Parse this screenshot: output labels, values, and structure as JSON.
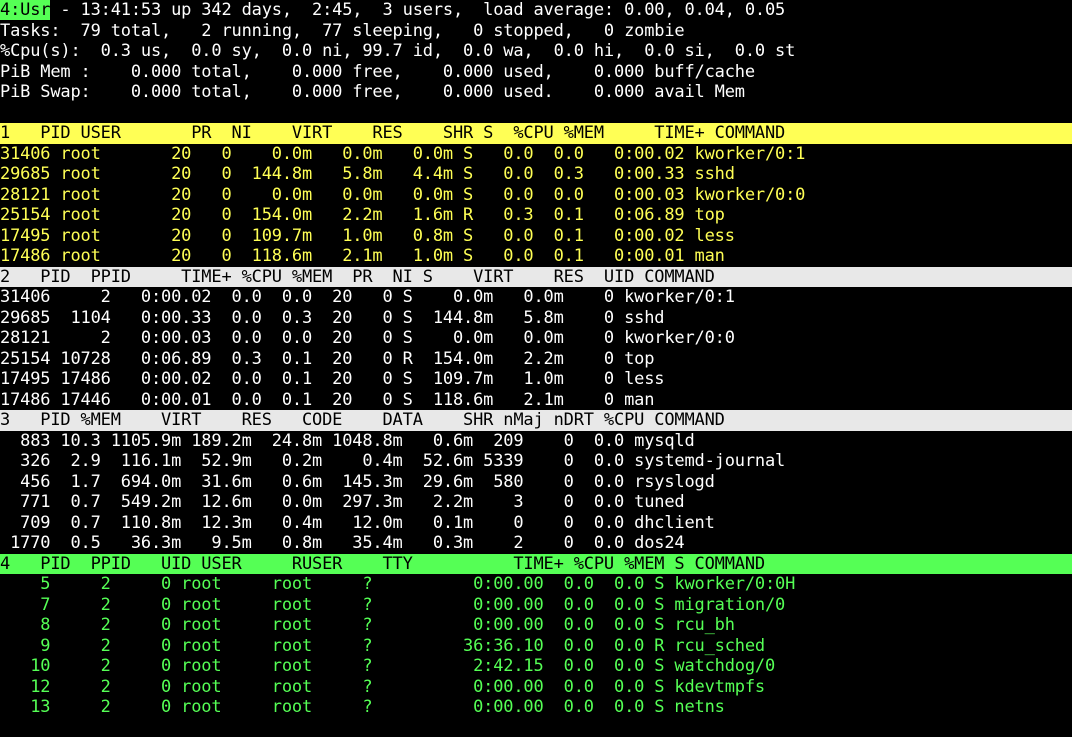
{
  "terminal": {
    "cols": 106,
    "rows": 36,
    "background": "#000000",
    "colors": {
      "yellow": "#ffff55",
      "green": "#55ff55",
      "white": "#ffffff",
      "grey_bar": "#e8e8e8",
      "black": "#000000"
    }
  },
  "summary": {
    "window_tag": "4:Usr",
    "uptime_line": " - 13:41:53 up 342 days,  2:45,  3 users,  load average: 0.00, 0.04, 0.05",
    "uptime": {
      "time": "13:41:53",
      "up": "342 days,  2:45",
      "users": "3",
      "load_average": [
        "0.00",
        "0.04",
        "0.05"
      ]
    },
    "tasks_line": "Tasks:  79 total,   2 running,  77 sleeping,   0 stopped,   0 zombie",
    "tasks": {
      "label": "Tasks:",
      "total": "79",
      "running": "2",
      "sleeping": "77",
      "stopped": "0",
      "zombie": "0"
    },
    "cpu_line": "%Cpu(s):  0.3 us,  0.0 sy,  0.0 ni, 99.7 id,  0.0 wa,  0.0 hi,  0.0 si,  0.0 st",
    "cpu": {
      "label": "%Cpu(s):",
      "us": "0.3",
      "sy": "0.0",
      "ni": "0.0",
      "id": "99.7",
      "wa": "0.0",
      "hi": "0.0",
      "si": "0.0",
      "st": "0.0"
    },
    "mem_line": "PiB Mem :    0.000 total,    0.000 free,    0.000 used,    0.000 buff/cache",
    "mem": {
      "label": "PiB Mem :",
      "total": "0.000",
      "free": "0.000",
      "used": "0.000",
      "buff_cache": "0.000"
    },
    "swap_line": "PiB Swap:    0.000 total,    0.000 free,    0.000 used.    0.000 avail Mem",
    "swap": {
      "label": "PiB Swap:",
      "total": "0.000",
      "free": "0.000",
      "used": "0.000",
      "avail_mem": "0.000"
    }
  },
  "windows": [
    {
      "id": "1",
      "name": "window-1-def",
      "header_color": "#ffff55",
      "text_color": "#ffff55",
      "header": "1   PID USER       PR  NI    VIRT    RES    SHR S  %CPU %MEM     TIME+ COMMAND",
      "columns": [
        "PID",
        "USER",
        "PR",
        "NI",
        "VIRT",
        "RES",
        "SHR",
        "S",
        "%CPU",
        "%MEM",
        "TIME+",
        "COMMAND"
      ],
      "rows": [
        "31406 root       20   0    0.0m   0.0m   0.0m S   0.0  0.0   0:00.02 kworker/0:1",
        "29685 root       20   0  144.8m   5.8m   4.4m S   0.0  0.3   0:00.33 sshd",
        "28121 root       20   0    0.0m   0.0m   0.0m S   0.0  0.0   0:00.03 kworker/0:0",
        "25154 root       20   0  154.0m   2.2m   1.6m R   0.3  0.1   0:06.89 top",
        "17495 root       20   0  109.7m   1.0m   0.8m S   0.0  0.1   0:00.02 less",
        "17486 root       20   0  118.6m   2.1m   1.0m S   0.0  0.1   0:00.01 man"
      ],
      "records": [
        {
          "PID": "31406",
          "USER": "root",
          "PR": "20",
          "NI": "0",
          "VIRT": "0.0m",
          "RES": "0.0m",
          "SHR": "0.0m",
          "S": "S",
          "%CPU": "0.0",
          "%MEM": "0.0",
          "TIME+": "0:00.02",
          "COMMAND": "kworker/0:1"
        },
        {
          "PID": "29685",
          "USER": "root",
          "PR": "20",
          "NI": "0",
          "VIRT": "144.8m",
          "RES": "5.8m",
          "SHR": "4.4m",
          "S": "S",
          "%CPU": "0.0",
          "%MEM": "0.3",
          "TIME+": "0:00.33",
          "COMMAND": "sshd"
        },
        {
          "PID": "28121",
          "USER": "root",
          "PR": "20",
          "NI": "0",
          "VIRT": "0.0m",
          "RES": "0.0m",
          "SHR": "0.0m",
          "S": "S",
          "%CPU": "0.0",
          "%MEM": "0.0",
          "TIME+": "0:00.03",
          "COMMAND": "kworker/0:0"
        },
        {
          "PID": "25154",
          "USER": "root",
          "PR": "20",
          "NI": "0",
          "VIRT": "154.0m",
          "RES": "2.2m",
          "SHR": "1.6m",
          "S": "R",
          "%CPU": "0.3",
          "%MEM": "0.1",
          "TIME+": "0:06.89",
          "COMMAND": "top"
        },
        {
          "PID": "17495",
          "USER": "root",
          "PR": "20",
          "NI": "0",
          "VIRT": "109.7m",
          "RES": "1.0m",
          "SHR": "0.8m",
          "S": "S",
          "%CPU": "0.0",
          "%MEM": "0.1",
          "TIME+": "0:00.02",
          "COMMAND": "less"
        },
        {
          "PID": "17486",
          "USER": "root",
          "PR": "20",
          "NI": "0",
          "VIRT": "118.6m",
          "RES": "2.1m",
          "SHR": "1.0m",
          "S": "S",
          "%CPU": "0.0",
          "%MEM": "0.1",
          "TIME+": "0:00.01",
          "COMMAND": "man"
        }
      ]
    },
    {
      "id": "2",
      "name": "window-2-job",
      "header_color": "#e8e8e8",
      "text_color": "#ffffff",
      "header": "2   PID  PPID     TIME+ %CPU %MEM  PR  NI S    VIRT    RES  UID COMMAND",
      "columns": [
        "PID",
        "PPID",
        "TIME+",
        "%CPU",
        "%MEM",
        "PR",
        "NI",
        "S",
        "VIRT",
        "RES",
        "UID",
        "COMMAND"
      ],
      "rows": [
        "31406     2   0:00.02  0.0  0.0  20   0 S    0.0m   0.0m    0 kworker/0:1",
        "29685  1104   0:00.33  0.0  0.3  20   0 S  144.8m   5.8m    0 sshd",
        "28121     2   0:00.03  0.0  0.0  20   0 S    0.0m   0.0m    0 kworker/0:0",
        "25154 10728   0:06.89  0.3  0.1  20   0 R  154.0m   2.2m    0 top",
        "17495 17486   0:00.02  0.0  0.1  20   0 S  109.7m   1.0m    0 less",
        "17486 17446   0:00.01  0.0  0.1  20   0 S  118.6m   2.1m    0 man"
      ],
      "records": [
        {
          "PID": "31406",
          "PPID": "2",
          "TIME+": "0:00.02",
          "%CPU": "0.0",
          "%MEM": "0.0",
          "PR": "20",
          "NI": "0",
          "S": "S",
          "VIRT": "0.0m",
          "RES": "0.0m",
          "UID": "0",
          "COMMAND": "kworker/0:1"
        },
        {
          "PID": "29685",
          "PPID": "1104",
          "TIME+": "0:00.33",
          "%CPU": "0.0",
          "%MEM": "0.3",
          "PR": "20",
          "NI": "0",
          "S": "S",
          "VIRT": "144.8m",
          "RES": "5.8m",
          "UID": "0",
          "COMMAND": "sshd"
        },
        {
          "PID": "28121",
          "PPID": "2",
          "TIME+": "0:00.03",
          "%CPU": "0.0",
          "%MEM": "0.0",
          "PR": "20",
          "NI": "0",
          "S": "S",
          "VIRT": "0.0m",
          "RES": "0.0m",
          "UID": "0",
          "COMMAND": "kworker/0:0"
        },
        {
          "PID": "25154",
          "PPID": "10728",
          "TIME+": "0:06.89",
          "%CPU": "0.3",
          "%MEM": "0.1",
          "PR": "20",
          "NI": "0",
          "S": "R",
          "VIRT": "154.0m",
          "RES": "2.2m",
          "UID": "0",
          "COMMAND": "top"
        },
        {
          "PID": "17495",
          "PPID": "17486",
          "TIME+": "0:00.02",
          "%CPU": "0.0",
          "%MEM": "0.1",
          "PR": "20",
          "NI": "0",
          "S": "S",
          "VIRT": "109.7m",
          "RES": "1.0m",
          "UID": "0",
          "COMMAND": "less"
        },
        {
          "PID": "17486",
          "PPID": "17446",
          "TIME+": "0:00.01",
          "%CPU": "0.0",
          "%MEM": "0.1",
          "PR": "20",
          "NI": "0",
          "S": "S",
          "VIRT": "118.6m",
          "RES": "2.1m",
          "UID": "0",
          "COMMAND": "man"
        }
      ]
    },
    {
      "id": "3",
      "name": "window-3-mem",
      "header_color": "#e8e8e8",
      "text_color": "#ffffff",
      "header": "3   PID %MEM    VIRT    RES   CODE    DATA    SHR nMaj nDRT %CPU COMMAND",
      "columns": [
        "PID",
        "%MEM",
        "VIRT",
        "RES",
        "CODE",
        "DATA",
        "SHR",
        "nMaj",
        "nDRT",
        "%CPU",
        "COMMAND"
      ],
      "rows": [
        "  883 10.3 1105.9m 189.2m  24.8m 1048.8m   0.6m  209    0  0.0 mysqld",
        "  326  2.9  116.1m  52.9m   0.2m    0.4m  52.6m 5339    0  0.0 systemd-journal",
        "  456  1.7  694.0m  31.6m   0.6m  145.3m  29.6m  580    0  0.0 rsyslogd",
        "  771  0.7  549.2m  12.6m   0.0m  297.3m   2.2m    3    0  0.0 tuned",
        "  709  0.7  110.8m  12.3m   0.4m   12.0m   0.1m    0    0  0.0 dhclient",
        " 1770  0.5   36.3m   9.5m   0.8m   35.4m   0.3m    2    0  0.0 dos24"
      ],
      "records": [
        {
          "PID": "883",
          "%MEM": "10.3",
          "VIRT": "1105.9m",
          "RES": "189.2m",
          "CODE": "24.8m",
          "DATA": "1048.8m",
          "SHR": "0.6m",
          "nMaj": "209",
          "nDRT": "0",
          "%CPU": "0.0",
          "COMMAND": "mysqld"
        },
        {
          "PID": "326",
          "%MEM": "2.9",
          "VIRT": "116.1m",
          "RES": "52.9m",
          "CODE": "0.2m",
          "DATA": "0.4m",
          "SHR": "52.6m",
          "nMaj": "5339",
          "nDRT": "0",
          "%CPU": "0.0",
          "COMMAND": "systemd-journal"
        },
        {
          "PID": "456",
          "%MEM": "1.7",
          "VIRT": "694.0m",
          "RES": "31.6m",
          "CODE": "0.6m",
          "DATA": "145.3m",
          "SHR": "29.6m",
          "nMaj": "580",
          "nDRT": "0",
          "%CPU": "0.0",
          "COMMAND": "rsyslogd"
        },
        {
          "PID": "771",
          "%MEM": "0.7",
          "VIRT": "549.2m",
          "RES": "12.6m",
          "CODE": "0.0m",
          "DATA": "297.3m",
          "SHR": "2.2m",
          "nMaj": "3",
          "nDRT": "0",
          "%CPU": "0.0",
          "COMMAND": "tuned"
        },
        {
          "PID": "709",
          "%MEM": "0.7",
          "VIRT": "110.8m",
          "RES": "12.3m",
          "CODE": "0.4m",
          "DATA": "12.0m",
          "SHR": "0.1m",
          "nMaj": "0",
          "nDRT": "0",
          "%CPU": "0.0",
          "COMMAND": "dhclient"
        },
        {
          "PID": "1770",
          "%MEM": "0.5",
          "VIRT": "36.3m",
          "RES": "9.5m",
          "CODE": "0.8m",
          "DATA": "35.4m",
          "SHR": "0.3m",
          "nMaj": "2",
          "nDRT": "0",
          "%CPU": "0.0",
          "COMMAND": "dos24"
        }
      ]
    },
    {
      "id": "4",
      "name": "window-4-usr",
      "header_color": "#55ff55",
      "text_color": "#55ff55",
      "header": "4   PID  PPID   UID USER     RUSER    TTY          TIME+ %CPU %MEM S COMMAND",
      "columns": [
        "PID",
        "PPID",
        "UID",
        "USER",
        "RUSER",
        "TTY",
        "TIME+",
        "%CPU",
        "%MEM",
        "S",
        "COMMAND"
      ],
      "rows": [
        "    5     2     0 root     root     ?          0:00.00  0.0  0.0 S kworker/0:0H",
        "    7     2     0 root     root     ?          0:00.00  0.0  0.0 S migration/0",
        "    8     2     0 root     root     ?          0:00.00  0.0  0.0 S rcu_bh",
        "    9     2     0 root     root     ?         36:36.10  0.0  0.0 R rcu_sched",
        "   10     2     0 root     root     ?          2:42.15  0.0  0.0 S watchdog/0",
        "   12     2     0 root     root     ?          0:00.00  0.0  0.0 S kdevtmpfs",
        "   13     2     0 root     root     ?          0:00.00  0.0  0.0 S netns"
      ],
      "records": [
        {
          "PID": "5",
          "PPID": "2",
          "UID": "0",
          "USER": "root",
          "RUSER": "root",
          "TTY": "?",
          "TIME+": "0:00.00",
          "%CPU": "0.0",
          "%MEM": "0.0",
          "S": "S",
          "COMMAND": "kworker/0:0H"
        },
        {
          "PID": "7",
          "PPID": "2",
          "UID": "0",
          "USER": "root",
          "RUSER": "root",
          "TTY": "?",
          "TIME+": "0:00.00",
          "%CPU": "0.0",
          "%MEM": "0.0",
          "S": "S",
          "COMMAND": "migration/0"
        },
        {
          "PID": "8",
          "PPID": "2",
          "UID": "0",
          "USER": "root",
          "RUSER": "root",
          "TTY": "?",
          "TIME+": "0:00.00",
          "%CPU": "0.0",
          "%MEM": "0.0",
          "S": "S",
          "COMMAND": "rcu_bh"
        },
        {
          "PID": "9",
          "PPID": "2",
          "UID": "0",
          "USER": "root",
          "RUSER": "root",
          "TTY": "?",
          "TIME+": "36:36.10",
          "%CPU": "0.0",
          "%MEM": "0.0",
          "S": "R",
          "COMMAND": "rcu_sched"
        },
        {
          "PID": "10",
          "PPID": "2",
          "UID": "0",
          "USER": "root",
          "RUSER": "root",
          "TTY": "?",
          "TIME+": "2:42.15",
          "%CPU": "0.0",
          "%MEM": "0.0",
          "S": "S",
          "COMMAND": "watchdog/0"
        },
        {
          "PID": "12",
          "PPID": "2",
          "UID": "0",
          "USER": "root",
          "RUSER": "root",
          "TTY": "?",
          "TIME+": "0:00.00",
          "%CPU": "0.0",
          "%MEM": "0.0",
          "S": "S",
          "COMMAND": "kdevtmpfs"
        },
        {
          "PID": "13",
          "PPID": "2",
          "UID": "0",
          "USER": "root",
          "RUSER": "root",
          "TTY": "?",
          "TIME+": "0:00.00",
          "%CPU": "0.0",
          "%MEM": "0.0",
          "S": "S",
          "COMMAND": "netns"
        }
      ]
    }
  ]
}
